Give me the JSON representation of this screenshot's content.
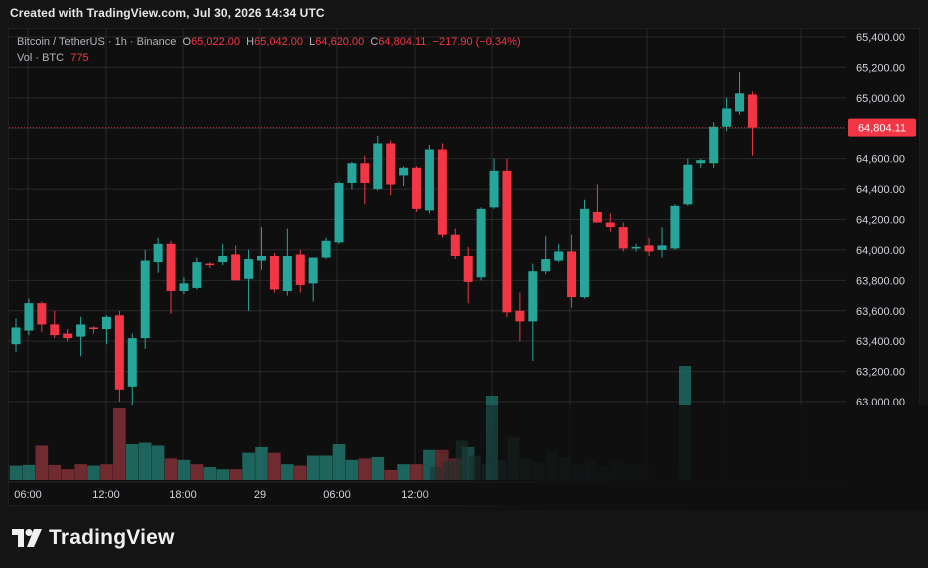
{
  "caption": "Created with TradingView.com, Jul 30, 2026 14:34 UTC",
  "legend": {
    "symbol": "Bitcoin / TetherUS · 1h · Binance",
    "o_label": "O",
    "o_value": "65,022.00",
    "h_label": "H",
    "h_value": "65,042.00",
    "l_label": "L",
    "l_value": "64,620.00",
    "c_label": "C",
    "c_value": "64,804.11",
    "change": "−217.90 (−0.34%)",
    "vol_label": "Vol · BTC",
    "vol_value": "775"
  },
  "price_tag": "64,804.11",
  "brand": "TradingView",
  "colors": {
    "up": "#26a69a",
    "down": "#f23645",
    "bg": "#0f0f0f",
    "grid": "#2a2a2a"
  },
  "chart_data": {
    "type": "candlestick",
    "y_ticks": [
      "65,400.00",
      "65,200.00",
      "65,000.00",
      "64,800.00",
      "64,600.00",
      "64,400.00",
      "64,200.00",
      "64,000.00",
      "63,800.00",
      "63,600.00",
      "63,400.00",
      "63,200.00",
      "63,000.00"
    ],
    "x_ticks": [
      "06:00",
      "12:00",
      "18:00",
      "29",
      "06:00",
      "12:00"
    ],
    "ylim": [
      62950,
      65450
    ],
    "last_price": 64804.11,
    "candles": [
      {
        "o": 63380,
        "h": 63550,
        "l": 63330,
        "c": 63490
      },
      {
        "o": 63470,
        "h": 63680,
        "l": 63440,
        "c": 63650
      },
      {
        "o": 63650,
        "h": 63660,
        "l": 63460,
        "c": 63510
      },
      {
        "o": 63510,
        "h": 63600,
        "l": 63420,
        "c": 63440
      },
      {
        "o": 63450,
        "h": 63480,
        "l": 63400,
        "c": 63420
      },
      {
        "o": 63430,
        "h": 63560,
        "l": 63300,
        "c": 63510
      },
      {
        "o": 63490,
        "h": 63500,
        "l": 63450,
        "c": 63480
      },
      {
        "o": 63480,
        "h": 63570,
        "l": 63380,
        "c": 63560
      },
      {
        "o": 63570,
        "h": 63600,
        "l": 63000,
        "c": 63080
      },
      {
        "o": 63100,
        "h": 63450,
        "l": 62980,
        "c": 63420
      },
      {
        "o": 63420,
        "h": 64000,
        "l": 63350,
        "c": 63930
      },
      {
        "o": 63920,
        "h": 64080,
        "l": 63850,
        "c": 64040
      },
      {
        "o": 64040,
        "h": 64060,
        "l": 63580,
        "c": 63730
      },
      {
        "o": 63730,
        "h": 63820,
        "l": 63710,
        "c": 63780
      },
      {
        "o": 63750,
        "h": 63950,
        "l": 63740,
        "c": 63920
      },
      {
        "o": 63910,
        "h": 63920,
        "l": 63880,
        "c": 63900
      },
      {
        "o": 63920,
        "h": 64040,
        "l": 63900,
        "c": 63960
      },
      {
        "o": 63970,
        "h": 64030,
        "l": 63800,
        "c": 63800
      },
      {
        "o": 63810,
        "h": 64000,
        "l": 63600,
        "c": 63940
      },
      {
        "o": 63930,
        "h": 64150,
        "l": 63870,
        "c": 63960
      },
      {
        "o": 63960,
        "h": 63980,
        "l": 63720,
        "c": 63740
      },
      {
        "o": 63730,
        "h": 64140,
        "l": 63700,
        "c": 63960
      },
      {
        "o": 63970,
        "h": 64000,
        "l": 63720,
        "c": 63770
      },
      {
        "o": 63780,
        "h": 63950,
        "l": 63660,
        "c": 63950
      },
      {
        "o": 63950,
        "h": 64080,
        "l": 63940,
        "c": 64060
      },
      {
        "o": 64050,
        "h": 64450,
        "l": 64040,
        "c": 64440
      },
      {
        "o": 64440,
        "h": 64580,
        "l": 64400,
        "c": 64570
      },
      {
        "o": 64570,
        "h": 64620,
        "l": 64300,
        "c": 64440
      },
      {
        "o": 64400,
        "h": 64750,
        "l": 64390,
        "c": 64700
      },
      {
        "o": 64700,
        "h": 64720,
        "l": 64360,
        "c": 64430
      },
      {
        "o": 64490,
        "h": 64550,
        "l": 64420,
        "c": 64540
      },
      {
        "o": 64540,
        "h": 64550,
        "l": 64250,
        "c": 64270
      },
      {
        "o": 64260,
        "h": 64690,
        "l": 64240,
        "c": 64660
      },
      {
        "o": 64660,
        "h": 64700,
        "l": 64080,
        "c": 64100
      },
      {
        "o": 64100,
        "h": 64140,
        "l": 63940,
        "c": 63960
      },
      {
        "o": 63960,
        "h": 64020,
        "l": 63650,
        "c": 63790
      },
      {
        "o": 63820,
        "h": 64280,
        "l": 63800,
        "c": 64270
      },
      {
        "o": 64280,
        "h": 64600,
        "l": 64270,
        "c": 64520
      },
      {
        "o": 64520,
        "h": 64600,
        "l": 63560,
        "c": 63590
      },
      {
        "o": 63600,
        "h": 63720,
        "l": 63400,
        "c": 63530
      },
      {
        "o": 63530,
        "h": 63910,
        "l": 63270,
        "c": 63860
      },
      {
        "o": 63860,
        "h": 64090,
        "l": 63840,
        "c": 63940
      },
      {
        "o": 63930,
        "h": 64040,
        "l": 63920,
        "c": 63990
      },
      {
        "o": 63990,
        "h": 64100,
        "l": 63620,
        "c": 63690
      },
      {
        "o": 63690,
        "h": 64330,
        "l": 63680,
        "c": 64270
      },
      {
        "o": 64250,
        "h": 64430,
        "l": 64180,
        "c": 64180
      },
      {
        "o": 64180,
        "h": 64240,
        "l": 64120,
        "c": 64150
      },
      {
        "o": 64150,
        "h": 64180,
        "l": 63990,
        "c": 64010
      },
      {
        "o": 64010,
        "h": 64040,
        "l": 63990,
        "c": 64020
      },
      {
        "o": 64030,
        "h": 64080,
        "l": 63960,
        "c": 63990
      },
      {
        "o": 64000,
        "h": 64150,
        "l": 63950,
        "c": 64030
      },
      {
        "o": 64010,
        "h": 64300,
        "l": 64000,
        "c": 64290
      },
      {
        "o": 64300,
        "h": 64600,
        "l": 64290,
        "c": 64560
      },
      {
        "o": 64570,
        "h": 64600,
        "l": 64540,
        "c": 64590
      },
      {
        "o": 64570,
        "h": 64840,
        "l": 64540,
        "c": 64810
      },
      {
        "o": 64810,
        "h": 65000,
        "l": 64780,
        "c": 64930
      },
      {
        "o": 64910,
        "h": 65170,
        "l": 64890,
        "c": 65030
      },
      {
        "o": 65022,
        "h": 65042,
        "l": 64620,
        "c": 64804.11
      }
    ],
    "volumes": [
      {
        "v": 0.2,
        "d": 0
      },
      {
        "v": 0.21,
        "d": 0
      },
      {
        "v": 0.48,
        "d": 1
      },
      {
        "v": 0.21,
        "d": 1
      },
      {
        "v": 0.15,
        "d": 1
      },
      {
        "v": 0.22,
        "d": 1
      },
      {
        "v": 0.2,
        "d": 0
      },
      {
        "v": 0.22,
        "d": 1
      },
      {
        "v": 1.0,
        "d": 1
      },
      {
        "v": 0.5,
        "d": 0
      },
      {
        "v": 0.52,
        "d": 0
      },
      {
        "v": 0.48,
        "d": 0
      },
      {
        "v": 0.3,
        "d": 1
      },
      {
        "v": 0.28,
        "d": 0
      },
      {
        "v": 0.22,
        "d": 1
      },
      {
        "v": 0.18,
        "d": 0
      },
      {
        "v": 0.15,
        "d": 0
      },
      {
        "v": 0.15,
        "d": 1
      },
      {
        "v": 0.38,
        "d": 0
      },
      {
        "v": 0.46,
        "d": 0
      },
      {
        "v": 0.38,
        "d": 1
      },
      {
        "v": 0.22,
        "d": 0
      },
      {
        "v": 0.2,
        "d": 1
      },
      {
        "v": 0.34,
        "d": 0
      },
      {
        "v": 0.34,
        "d": 0
      },
      {
        "v": 0.5,
        "d": 0
      },
      {
        "v": 0.28,
        "d": 0
      },
      {
        "v": 0.3,
        "d": 1
      },
      {
        "v": 0.32,
        "d": 0
      },
      {
        "v": 0.14,
        "d": 1
      },
      {
        "v": 0.22,
        "d": 0
      },
      {
        "v": 0.22,
        "d": 1
      },
      {
        "v": 0.42,
        "d": 0
      },
      {
        "v": 0.42,
        "d": 1
      },
      {
        "v": 0.3,
        "d": 1
      },
      {
        "v": 0.46,
        "d": 0
      }
    ]
  }
}
